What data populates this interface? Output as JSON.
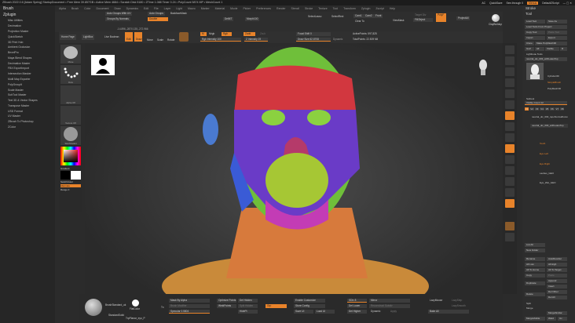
{
  "title": "ZBrush 2022.0.6 [Adam Spring]   StartupDocument   • Free Mem 39.857GB • Active Mem 4684 • Scratch Disk 5180 • ZTime 1.088 Timer 0.24 • PolyCount 5874 MP • MeshCount 1",
  "titlebar": {
    "ac": "AC",
    "quicksave": "QuickSave",
    "seethrough": "See-through 0",
    "menus": "Menus",
    "script": "DefaultZScript"
  },
  "left": {
    "brush": "Brush",
    "zplugin": "Zplugin",
    "plugins": [
      "Misc Utilities",
      "Decimation",
      "Projection Master",
      "QuickSketch",
      "3D Print Hub",
      "Ambient Occlusion",
      "BevelPro",
      "Maya Blend Shapes",
      "Decimation Master",
      "FBX ExportImport",
      "Intersection Masker",
      "Multi Map Exporter",
      "PolyGroupIt",
      "Scale Master",
      "SubTool Master",
      "Text 3D & Vector Shapes",
      "Transpose Master",
      "USD Format",
      "UV Master",
      "ZBrush To Photoshop",
      "ZColor"
    ]
  },
  "menubar": [
    "Alpha",
    "Brush",
    "Color",
    "Document",
    "Draw",
    "Dynamics",
    "Edit",
    "File",
    "Layer",
    "Light",
    "Macro",
    "Marker",
    "Material",
    "Movie",
    "Picker",
    "Preferences",
    "Render",
    "Stencil",
    "Stroke",
    "Texture",
    "Tool",
    "Transform",
    "Zplugin",
    "Zscript",
    "Help"
  ],
  "shelf": {
    "auto_groups_uv": "Auto Groups With UV",
    "auto_groups": "Auto Groups",
    "backface": "BackfaceMask",
    "groups_normals": "Groups By Normals",
    "double": "Double",
    "delmt": "DelMT",
    "morph": "Morph",
    "morph100": "Morph100",
    "selectlasso": "SelectLasso",
    "selectrect": "SelectRect",
    "cam1": "Cam1",
    "cam2": "Cam2",
    "front": "Front",
    "clearto": "Clear To",
    "viewmask": "ViewMask",
    "targetdiv": "Target Div",
    "fillobject": "FillObject",
    "polyf": "PolyF",
    "projectall": "ProjectAll",
    "clayBuildup": "ClayBuildup"
  },
  "coords": "-14.896,-2870.135,-272.966",
  "toolsrow": {
    "home": "Home Page",
    "lightbox": "LightBox",
    "livebool": "Live Boolean",
    "edit": "Edit",
    "draw": "Draw",
    "move": "Move",
    "scale": "Scale",
    "rotate": "Rotate",
    "mrgb": "Mrgb",
    "rgb": "Rgb",
    "m": "M",
    "zadd": "Zadd",
    "zsub": "Zsub",
    "rgb_intensity": "Rgb Intensity 100",
    "z_intensity": "Z Intensity 19",
    "focal": "Focal Shift 0",
    "draw_size": "Draw Size 62.8708",
    "dynamic": "Dynamic",
    "active_points": "ActivePoints: 597,825",
    "total_points": "TotalPoints: 22.509 Mil"
  },
  "lcol": {
    "move": "Move",
    "dots": "Dots",
    "alpha": "Alpha Off",
    "texture": "Texture Off",
    "material": "SkinShade4",
    "gradient": "Gradient",
    "switch": "SwitchColor",
    "alternate": "Alternate",
    "range": "Range 0"
  },
  "right": {
    "stroke": "Stroke",
    "tool": "Tool",
    "load": "Load Tool",
    "saveas": "Save As",
    "loadproj": "Load Tools From Project",
    "copy": "Copy Tool",
    "paste": "Paste Tool",
    "import": "Import",
    "export": "Export",
    "clone": "Clone",
    "polymesh": "Make PolyMesh3D",
    "goz": "GoZ",
    "all": "All",
    "visible": "Visible",
    "r": "R",
    "lightbox_tools": "Lightbox▸ Tools",
    "current": "neutral_ulc_003_withLatesTop",
    "cyl": "Cylinder3D",
    "simple": "SimpleBrush",
    "poly": "PolyMesh3D",
    "subtool": "Subtool",
    "visible_count": "Visible Count 12",
    "vs": [
      "V1",
      "V2",
      "V3",
      "V4",
      "V5",
      "V6",
      "V7",
      "V8"
    ],
    "sub1": "neutral_ulc_003_topoNormalFocus",
    "sub2": "neutral_ulc_003_withLatesTop",
    "folders": [
      "Tooth",
      "Eye Left",
      "Eye Right"
    ],
    "lashes": "Lashes_GEO",
    "eyewet": "Eye_Wet_GEO",
    "listall": "List All",
    "newfolder": "New Folder",
    "rename": "Rename",
    "autoreorder": "AutoReorder",
    "alllow": "All Low",
    "allhigh": "All High",
    "alltohome": "All To Home",
    "alltotarget": "All To Target",
    "copy2": "Copy",
    "paste2": "Paste",
    "duplicate": "Duplicate",
    "append": "Append",
    "insert": "Insert",
    "delete": "Delete",
    "delother": "Del Other",
    "delall": "Del All",
    "split": "Split",
    "merge": "Merge",
    "mergesimilar": "MergeSimilar",
    "mergevisible": "MergeVisible",
    "weld": "Weld",
    "uv": "Uv"
  },
  "bottom": {
    "brush": "BrushStandard_uk",
    "stdsolid": "StandardSolid",
    "flatcolor": "FlatColor",
    "trip": "TrpPlanar_eyo_P",
    "mask_alpha": "Mask By Alpha",
    "brush_modifier": "Brush Modifier",
    "specular": "Specular 0.5804",
    "tx": "Tx",
    "optimize": "Optimize Points",
    "weldpoints": "WeldPoints",
    "delhidden": "Del Hidden",
    "splithidden": "Split Hidden",
    "hidepl": "HidePt",
    "grp": "Grp",
    "enable_custom": "Enable Customize",
    "store_config": "Store Config",
    "save_ui": "Save UI",
    "load_ui": "Load UI",
    "sdiv": "SDiv 8",
    "dellower": "Del Lower",
    "delhigher": "Del Higher",
    "mirror": "Mirror",
    "reconstruct": "Reconstruct Subdiv",
    "dynamic": "Dynamic",
    "apply": "Apply",
    "lazymouse": "LazyMouse",
    "lazystep": "LazyStep",
    "lazysmooth": "LazySmooth",
    "bakeall": "Bake All"
  }
}
